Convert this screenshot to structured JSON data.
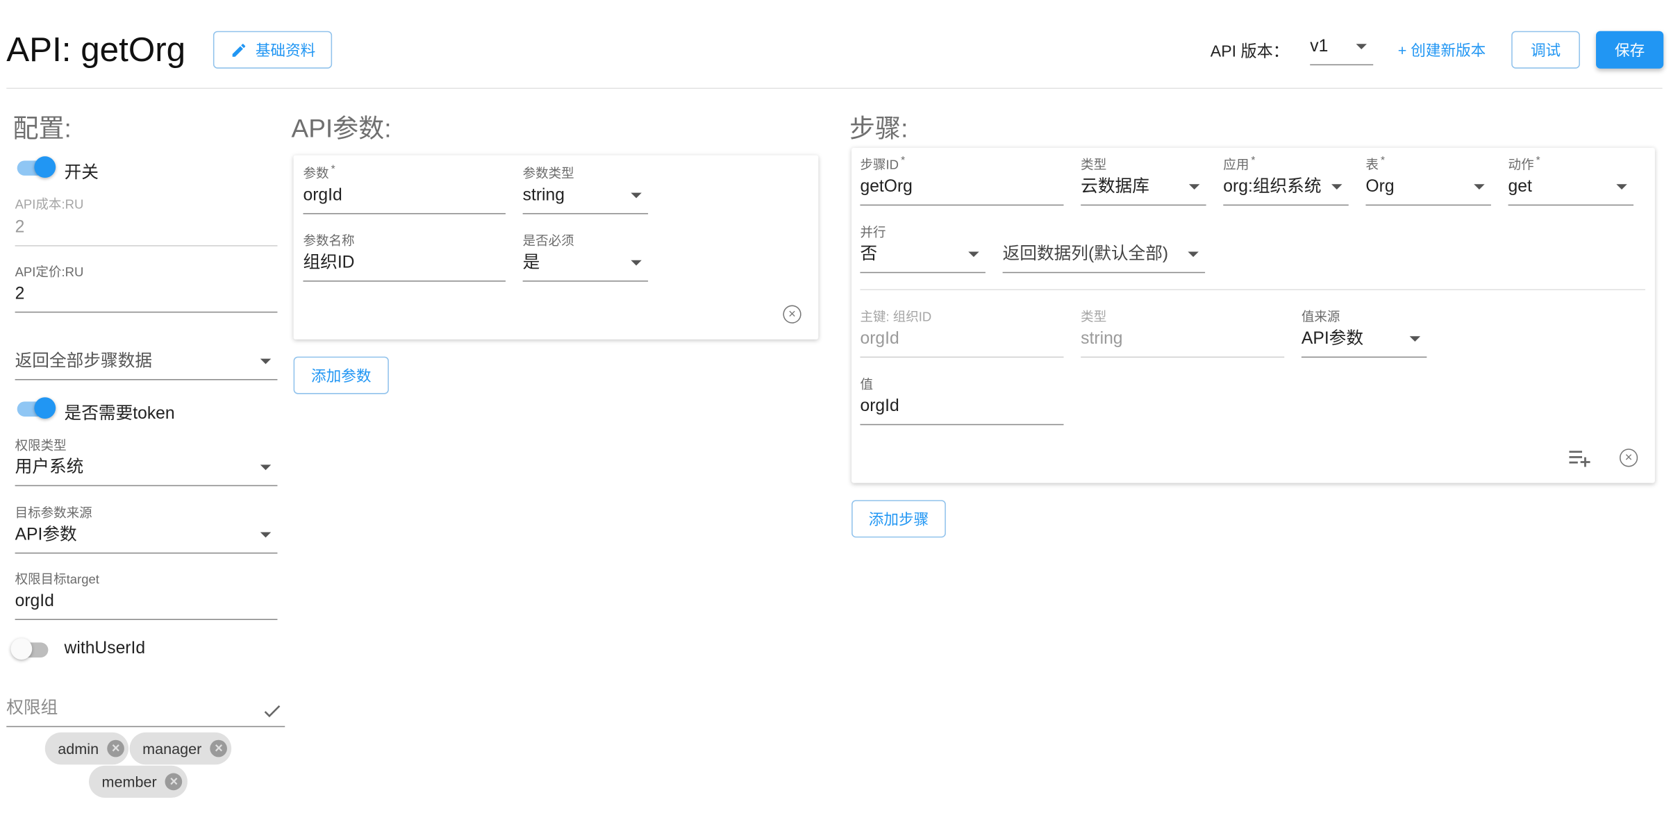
{
  "header": {
    "title": "API: getOrg",
    "basic_info_label": "基础资料",
    "version_label": "API 版本：",
    "version_value": "v1",
    "create_version_label": "+ 创建新版本",
    "debug_label": "调试",
    "save_label": "保存"
  },
  "config": {
    "heading": "配置:",
    "switch_label": "开关",
    "switch_on": true,
    "api_cost_label": "API成本:RU",
    "api_cost_value": "2",
    "api_price_label": "API定价:RU",
    "api_price_value": "2",
    "return_mode_value": "返回全部步骤数据",
    "need_token_label": "是否需要token",
    "need_token_on": true,
    "perm_type_label": "权限类型",
    "perm_type_value": "用户系统",
    "target_source_label": "目标参数来源",
    "target_source_value": "API参数",
    "perm_target_label": "权限目标target",
    "perm_target_value": "orgId",
    "with_user_id_label": "withUserId",
    "with_user_id_on": false,
    "perm_group_placeholder": "权限组",
    "perm_groups": [
      "admin",
      "manager",
      "member"
    ]
  },
  "params": {
    "heading": "API参数:",
    "param_label": "参数",
    "param_value": "orgId",
    "param_type_label": "参数类型",
    "param_type_value": "string",
    "param_name_label": "参数名称",
    "param_name_value": "组织ID",
    "required_label": "是否必须",
    "required_value": "是",
    "add_param_label": "添加参数"
  },
  "steps": {
    "heading": "步骤:",
    "step_id_label": "步骤ID",
    "step_id_value": "getOrg",
    "type_label": "类型",
    "type_value": "云数据库",
    "app_label": "应用",
    "app_value": "org:组织系统",
    "table_label": "表",
    "table_value": "Org",
    "action_label": "动作",
    "action_value": "get",
    "parallel_label": "并行",
    "parallel_value": "否",
    "return_cols_value": "返回数据列(默认全部)",
    "key_label": "主键: 组织ID",
    "key_value": "orgId",
    "key_type_label": "类型",
    "key_type_value": "string",
    "value_source_label": "值来源",
    "value_source_value": "API参数",
    "value_label": "值",
    "value_value": "orgId",
    "add_step_label": "添加步骤"
  },
  "colors": {
    "primary": "#2196f3",
    "outline": "#90c2ec",
    "chip_bg": "#e0e0e0"
  }
}
